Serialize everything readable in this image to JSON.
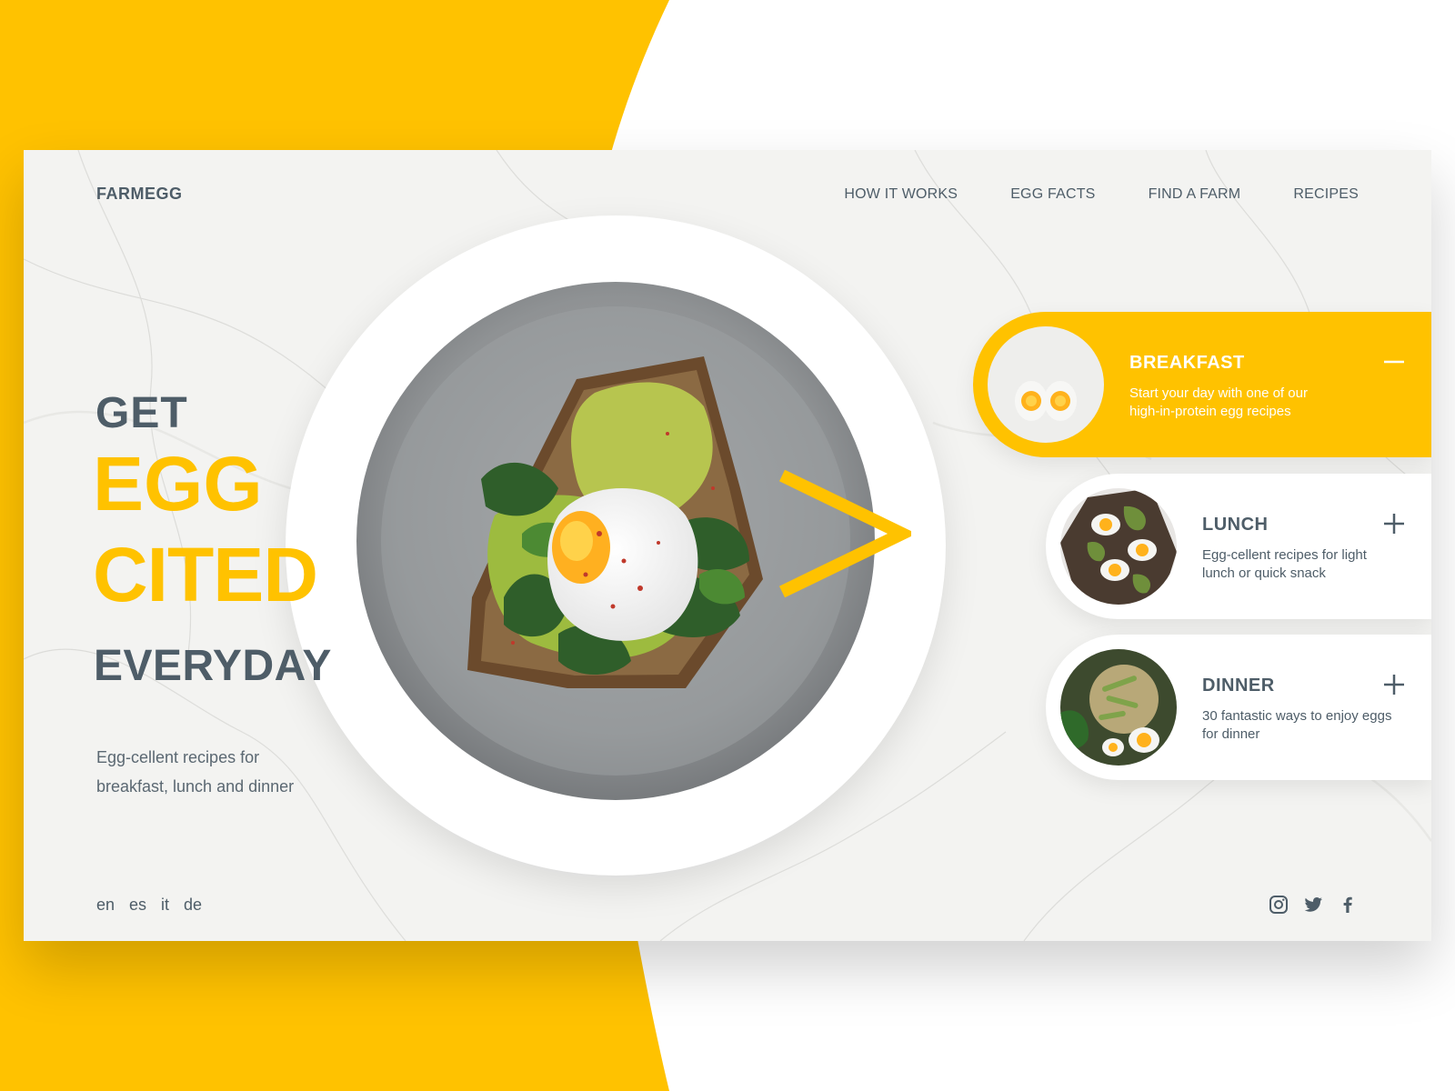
{
  "brand": {
    "logo": "FARMEGG"
  },
  "nav": {
    "items": [
      "HOW IT WORKS",
      "EGG FACTS",
      "FIND A FARM",
      "RECIPES"
    ]
  },
  "hero": {
    "line1": "GET",
    "line2": "EGG",
    "line3": "CITED",
    "line4": "EVERYDAY",
    "tagline": "Egg-cellent recipes for breakfast, lunch and dinner"
  },
  "meals": [
    {
      "title": "BREAKFAST",
      "desc": "Start your day with one of our high-in-protein egg recipes",
      "state": "expanded"
    },
    {
      "title": "LUNCH",
      "desc": "Egg-cellent recipes for light lunch or quick snack",
      "state": "collapsed"
    },
    {
      "title": "DINNER",
      "desc": "30 fantastic ways to enjoy eggs for dinner",
      "state": "collapsed"
    }
  ],
  "languages": [
    "en",
    "es",
    "it",
    "de"
  ],
  "social": [
    "instagram-icon",
    "twitter-icon",
    "facebook-icon"
  ],
  "colors": {
    "accent": "#ffc200",
    "text": "#4e5d68",
    "white": "#ffffff"
  }
}
